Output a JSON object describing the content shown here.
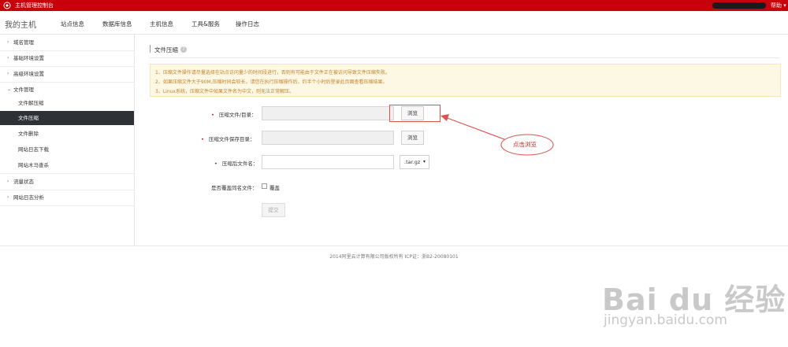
{
  "topbar": {
    "app_title": "主机管理控制台",
    "help": "帮助"
  },
  "nav": {
    "brand": "我的主机",
    "items": [
      "站点信息",
      "数据库信息",
      "主机信息",
      "工具&服务",
      "操作日志"
    ]
  },
  "sidebar": {
    "groups": [
      {
        "label": "域名管理"
      },
      {
        "label": "基础环境设置"
      },
      {
        "label": "高级环境设置"
      },
      {
        "label": "文件管理"
      }
    ],
    "sub_items": [
      "文件解压缩",
      "文件压缩",
      "文件删除",
      "网站日志下载",
      "网站木马查杀"
    ],
    "active_index": 1,
    "bottom_groups": [
      {
        "label": "流量状态"
      },
      {
        "label": "网站日志分析"
      }
    ]
  },
  "content": {
    "title": "文件压缩",
    "notice": [
      "1、压缩文件操作请尽量选择在站点访问量少的时间段进行，否则有可能由于文件正在被访问导致文件压缩失败。",
      "2、如果压缩文件大于90M,压缩时间会较长，请您在执行压缩操作后，约半个小时后登录此页面查看压缩结果。",
      "3、Linux系统，压缩文件中如果文件名为中文，则无法正常解压。"
    ],
    "form": {
      "source_label": "压缩文件/目录：",
      "save_dir_label": "压缩文件保存目录：",
      "filename_label": "压缩后文件名：",
      "browse_label": "浏览",
      "format_value": ".tar.gz",
      "overwrite_label": "是否覆盖同名文件：",
      "overwrite_option": "覆盖",
      "submit_label": "提交"
    },
    "annotation": "点击浏览"
  },
  "footer": {
    "text": "2014阿里云计算有限公司版权所有 ICP证：浙B2-20080101"
  },
  "watermark": {
    "logo": "Bai du 经验",
    "url": "jingyan.baidu.com"
  },
  "colors": {
    "brand_red": "#c7000b",
    "active_bg": "#2e3237",
    "notice_bg": "#fdf8e4",
    "notice_text": "#c77f2d"
  }
}
